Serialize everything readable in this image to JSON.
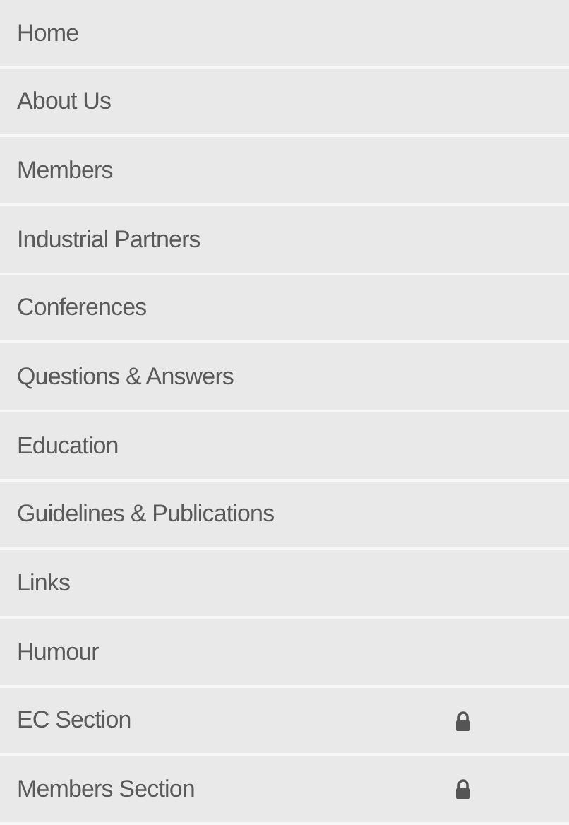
{
  "menu": [
    {
      "label": "Home",
      "locked": false
    },
    {
      "label": "About Us",
      "locked": false
    },
    {
      "label": "Members",
      "locked": false
    },
    {
      "label": "Industrial Partners",
      "locked": false
    },
    {
      "label": "Conferences",
      "locked": false
    },
    {
      "label": "Questions & Answers",
      "locked": false
    },
    {
      "label": "Education",
      "locked": false
    },
    {
      "label": "Guidelines & Publications",
      "locked": false
    },
    {
      "label": "Links",
      "locked": false
    },
    {
      "label": "Humour",
      "locked": false
    },
    {
      "label": "EC Section",
      "locked": true
    },
    {
      "label": "Members Section",
      "locked": true
    }
  ]
}
